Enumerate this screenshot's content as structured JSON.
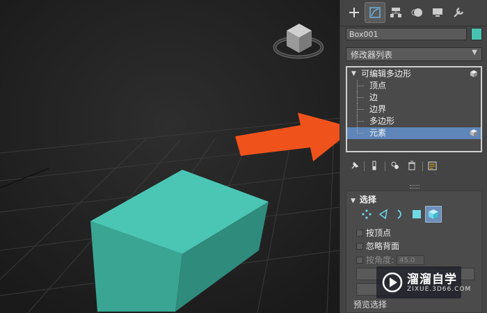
{
  "command_panel": {
    "tabs": [
      {
        "icon": "plus-create-icon",
        "active": false
      },
      {
        "icon": "modify-icon",
        "active": true
      },
      {
        "icon": "hierarchy-icon",
        "active": false
      },
      {
        "icon": "motion-icon",
        "active": false
      },
      {
        "icon": "display-icon",
        "active": false
      },
      {
        "icon": "utilities-wrench-icon",
        "active": false
      }
    ],
    "object_name": "Box001",
    "object_color": "#48c3b1",
    "modifier_list_label": "修改器列表",
    "modifier_stack": {
      "root_label": "可编辑多边形",
      "items": [
        "顶点",
        "边",
        "边界",
        "多边形",
        "元素"
      ],
      "selected": "元素"
    },
    "selection_rollout": {
      "title": "选择",
      "by_vertex": "按顶点",
      "ignore_backfacing": "忽略背面",
      "by_angle": "按角度:",
      "angle_value": "45.0",
      "preview_label": "预览选择"
    }
  },
  "watermark": {
    "text": "溜溜自学",
    "url": "ZIXUE.3D66.COM"
  },
  "colors": {
    "box_top": "#4cc6b4",
    "box_front": "#3aa593",
    "box_side": "#2f8b7b",
    "arrow": "#f0521c",
    "selection": "#5f86b9"
  }
}
